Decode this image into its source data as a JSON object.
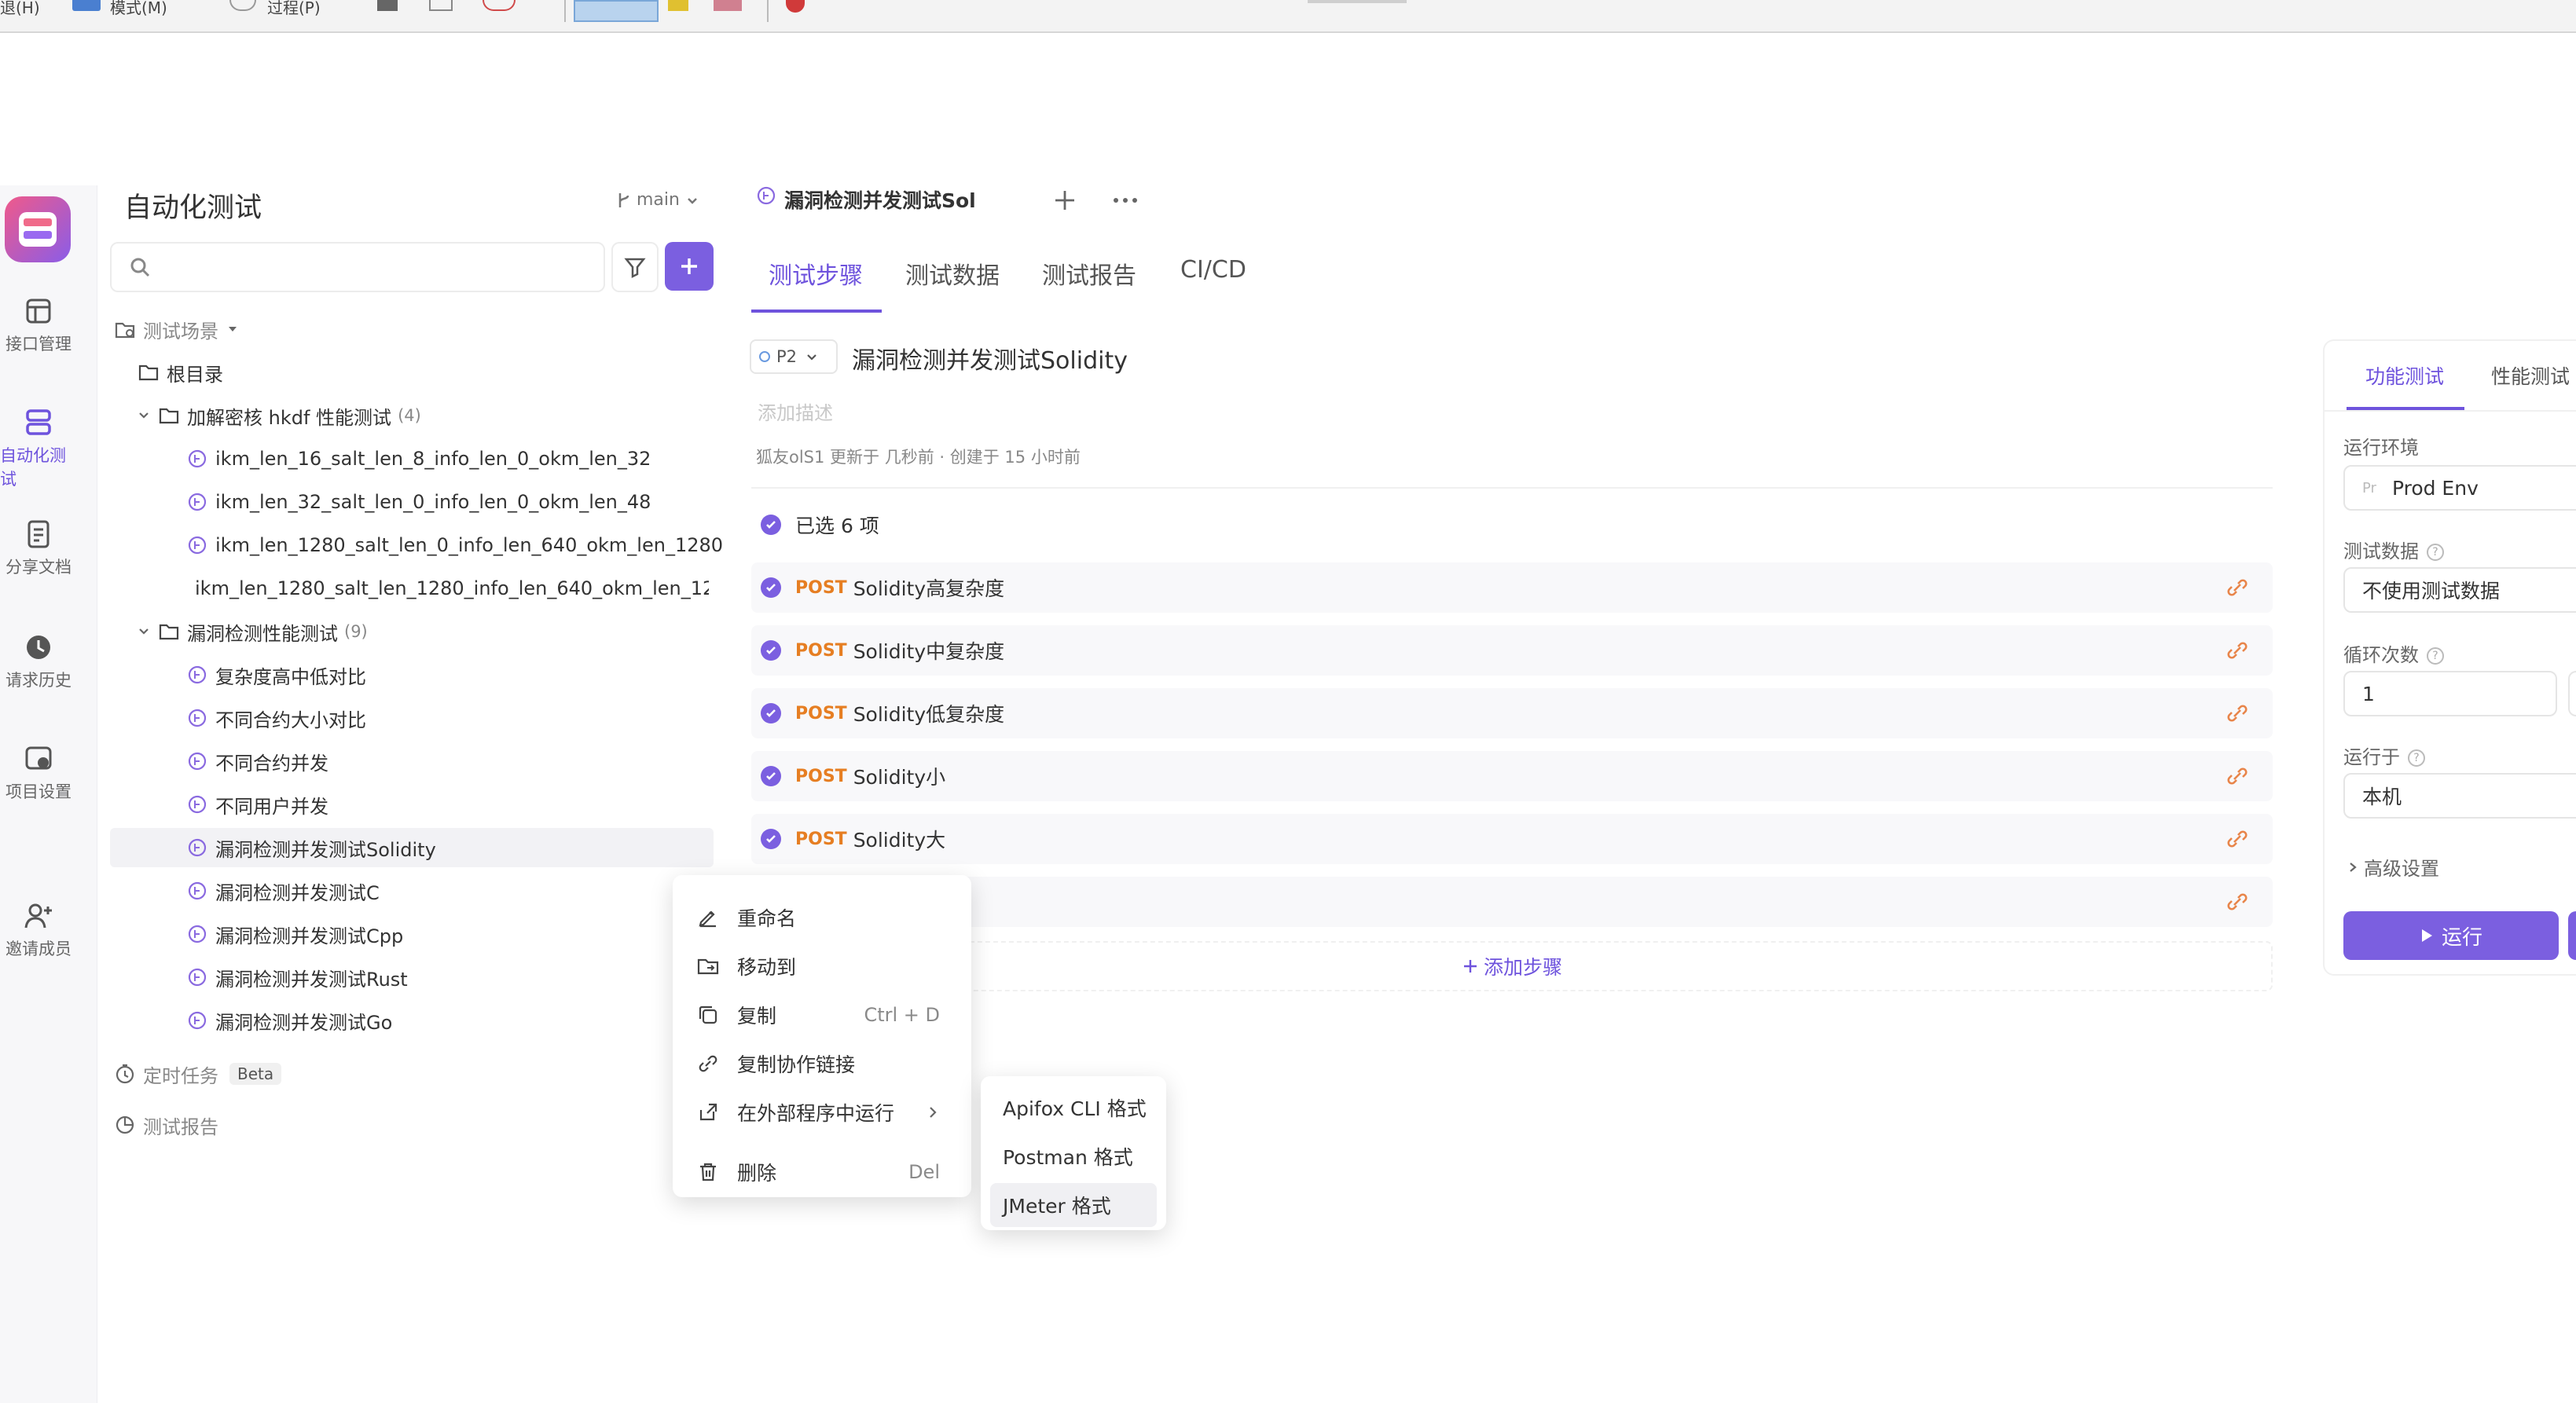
{
  "topbar": {
    "items": [
      "退(H)",
      "模式(M)",
      "过程(P)"
    ]
  },
  "rail": {
    "items": [
      {
        "label": "接口管理",
        "icon": "api-icon"
      },
      {
        "label": "自动化测试",
        "icon": "automation-icon",
        "active": true
      },
      {
        "label": "分享文档",
        "icon": "share-doc-icon"
      },
      {
        "label": "请求历史",
        "icon": "history-icon"
      },
      {
        "label": "项目设置",
        "icon": "settings-icon"
      },
      {
        "label": "邀请成员",
        "icon": "invite-icon"
      }
    ]
  },
  "tree": {
    "title": "自动化测试",
    "branch": "main",
    "search_placeholder": "",
    "section_scenes": "测试场景",
    "root": "根目录",
    "folder1": {
      "name": "加解密核 hkdf 性能测试",
      "count": "(4)"
    },
    "folder1_items": [
      "ikm_len_16_salt_len_8_info_len_0_okm_len_32",
      "ikm_len_32_salt_len_0_info_len_0_okm_len_48",
      "ikm_len_1280_salt_len_0_info_len_640_okm_len_1280",
      "ikm_len_1280_salt_len_1280_info_len_640_okm_len_12"
    ],
    "folder2": {
      "name": "漏洞检测性能测试",
      "count": "(9)"
    },
    "folder2_items": [
      "复杂度高中低对比",
      "不同合约大小对比",
      "不同合约并发",
      "不同用户并发",
      "漏洞检测并发测试Solidity",
      "漏洞检测并发测试C",
      "漏洞检测并发测试Cpp",
      "漏洞检测并发测试Rust",
      "漏洞检测并发测试Go"
    ],
    "scheduled": "定时任务",
    "beta": "Beta",
    "reports": "测试报告"
  },
  "main": {
    "open_tab": "漏洞检测并发测试Sol",
    "tabs": [
      "测试步骤",
      "测试数据",
      "测试报告",
      "CI/CD"
    ],
    "priority": "P2",
    "title": "漏洞检测并发测试Solidity",
    "desc_placeholder": "添加描述",
    "meta": "狐友olS1 更新于 几秒前 · 创建于 15 小时前",
    "selected": "已选 6 项",
    "method": "POST",
    "steps": [
      "Solidity高复杂度",
      "Solidity中复杂度",
      "Solidity低复杂度",
      "Solidity小",
      "Solidity大"
    ],
    "add_step": "添加步骤"
  },
  "context_menu": {
    "items": [
      {
        "label": "重命名",
        "icon": "edit-icon",
        "shortcut": ""
      },
      {
        "label": "移动到",
        "icon": "move-icon",
        "shortcut": ""
      },
      {
        "label": "复制",
        "icon": "copy-icon",
        "shortcut": "Ctrl + D"
      },
      {
        "label": "复制协作链接",
        "icon": "link-icon",
        "shortcut": ""
      },
      {
        "label": "在外部程序中运行",
        "icon": "external-icon",
        "shortcut": ""
      },
      {
        "label": "删除",
        "icon": "trash-icon",
        "shortcut": "Del"
      }
    ],
    "submenu": [
      "Apifox CLI 格式",
      "Postman 格式",
      "JMeter 格式"
    ]
  },
  "right_panel": {
    "tabs": [
      "功能测试",
      "性能测试"
    ],
    "env_label": "运行环境",
    "env_prefix": "Pr",
    "env_value": "Prod Env",
    "data_label": "测试数据",
    "data_value": "不使用测试数据",
    "loop_label": "循环次数",
    "loop_value": "1",
    "runon_label": "运行于",
    "runon_value": "本机",
    "advanced": "高级设置",
    "run_button": "运行"
  },
  "colors": {
    "accent": "#6e53dd",
    "post": "#e67e22",
    "icon_orange": "#e8854a"
  }
}
